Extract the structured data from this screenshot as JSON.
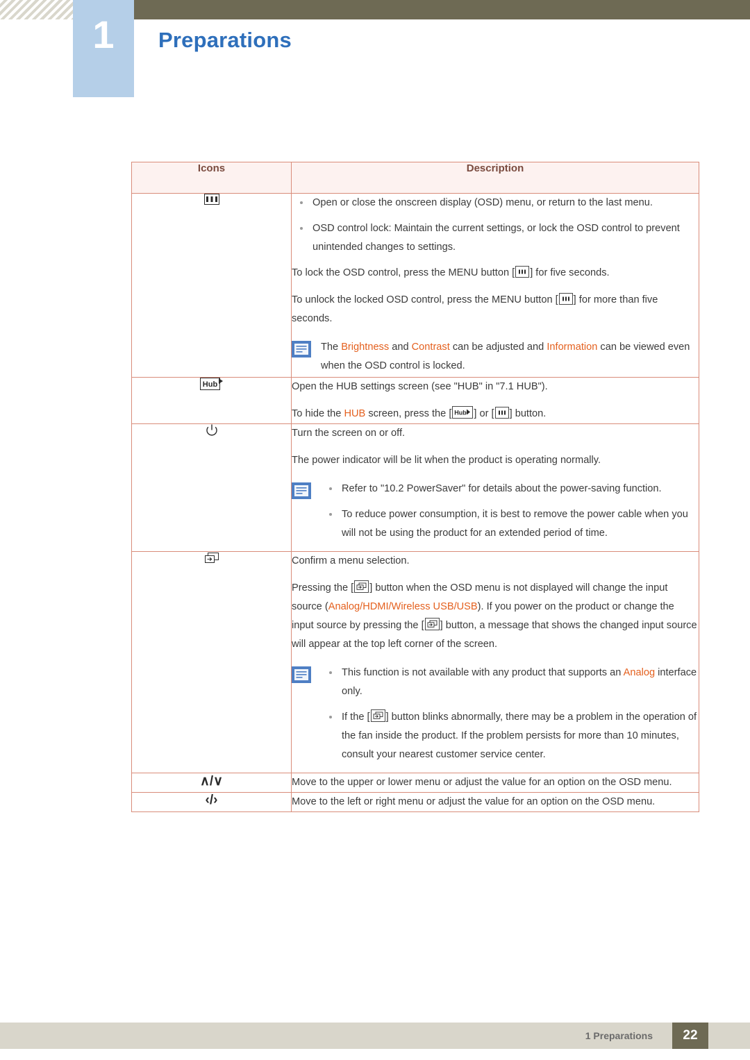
{
  "header": {
    "chapter_number": "1",
    "chapter_title": "Preparations"
  },
  "table": {
    "headers": {
      "icons": "Icons",
      "description": "Description"
    },
    "rows": [
      {
        "icon_name": "menu-icon",
        "bullets": [
          "Open or close the onscreen display (OSD) menu, or return to the last menu.",
          "OSD control lock: Maintain the current settings, or lock the OSD control to prevent unintended changes to settings."
        ],
        "para1_a": "To lock the OSD control, press the MENU button [",
        "para1_b": "] for five seconds.",
        "para2_a": "To unlock the locked OSD control, press the MENU button [",
        "para2_b": "] for more than five seconds.",
        "note_a": "The ",
        "note_brightness": "Brightness",
        "note_b": " and ",
        "note_contrast": "Contrast",
        "note_c": " can be adjusted and ",
        "note_information": "Information",
        "note_d": " can be viewed even when the OSD control is locked."
      },
      {
        "icon_name": "hub-icon",
        "line1": "Open the HUB settings screen (see \"HUB\" in \"7.1 HUB\").",
        "line2_a": "To hide the ",
        "line2_hub": "HUB",
        "line2_b": " screen, press the [",
        "line2_c": "] or [",
        "line2_d": "] button."
      },
      {
        "icon_name": "power-icon",
        "line1": "Turn the screen on or off.",
        "line2": "The power indicator will be lit when the product is operating normally.",
        "note_bullets": [
          "Refer to \"10.2 PowerSaver\" for details about the power-saving function.",
          "To reduce power consumption, it is best to remove the power cable when you will not be using the product for an extended period of time."
        ]
      },
      {
        "icon_name": "source-icon",
        "line1": "Confirm a menu selection.",
        "line2_a": "Pressing the [",
        "line2_b": "] button when the OSD menu is not displayed will change the input source (",
        "line2_sources": "Analog/HDMI/Wireless USB/USB",
        "line2_c": "). If you power on the product or change the input source by pressing the [",
        "line2_d": "] button, a message that shows the changed input source will appear at the top left corner of the screen.",
        "note_b1_a": "This function is not available with any product that supports an ",
        "note_b1_analog": "Analog",
        "note_b1_b": " interface only.",
        "note_b2_a": "If the [",
        "note_b2_b": "] button blinks abnormally, there may be a problem in the operation of the fan inside the product. If the problem persists for more than 10 minutes, consult your nearest customer service center."
      },
      {
        "icon_name": "up-down-icon",
        "icon_label": "∧/∨",
        "line1": "Move to the upper or lower menu or adjust the value for an option on the OSD menu."
      },
      {
        "icon_name": "left-right-icon",
        "icon_label": "‹/›",
        "line1": "Move to the left or right menu or adjust the value for an option on the OSD menu."
      }
    ]
  },
  "footer": {
    "chapter_label": "1 Preparations",
    "page_number": "22"
  }
}
